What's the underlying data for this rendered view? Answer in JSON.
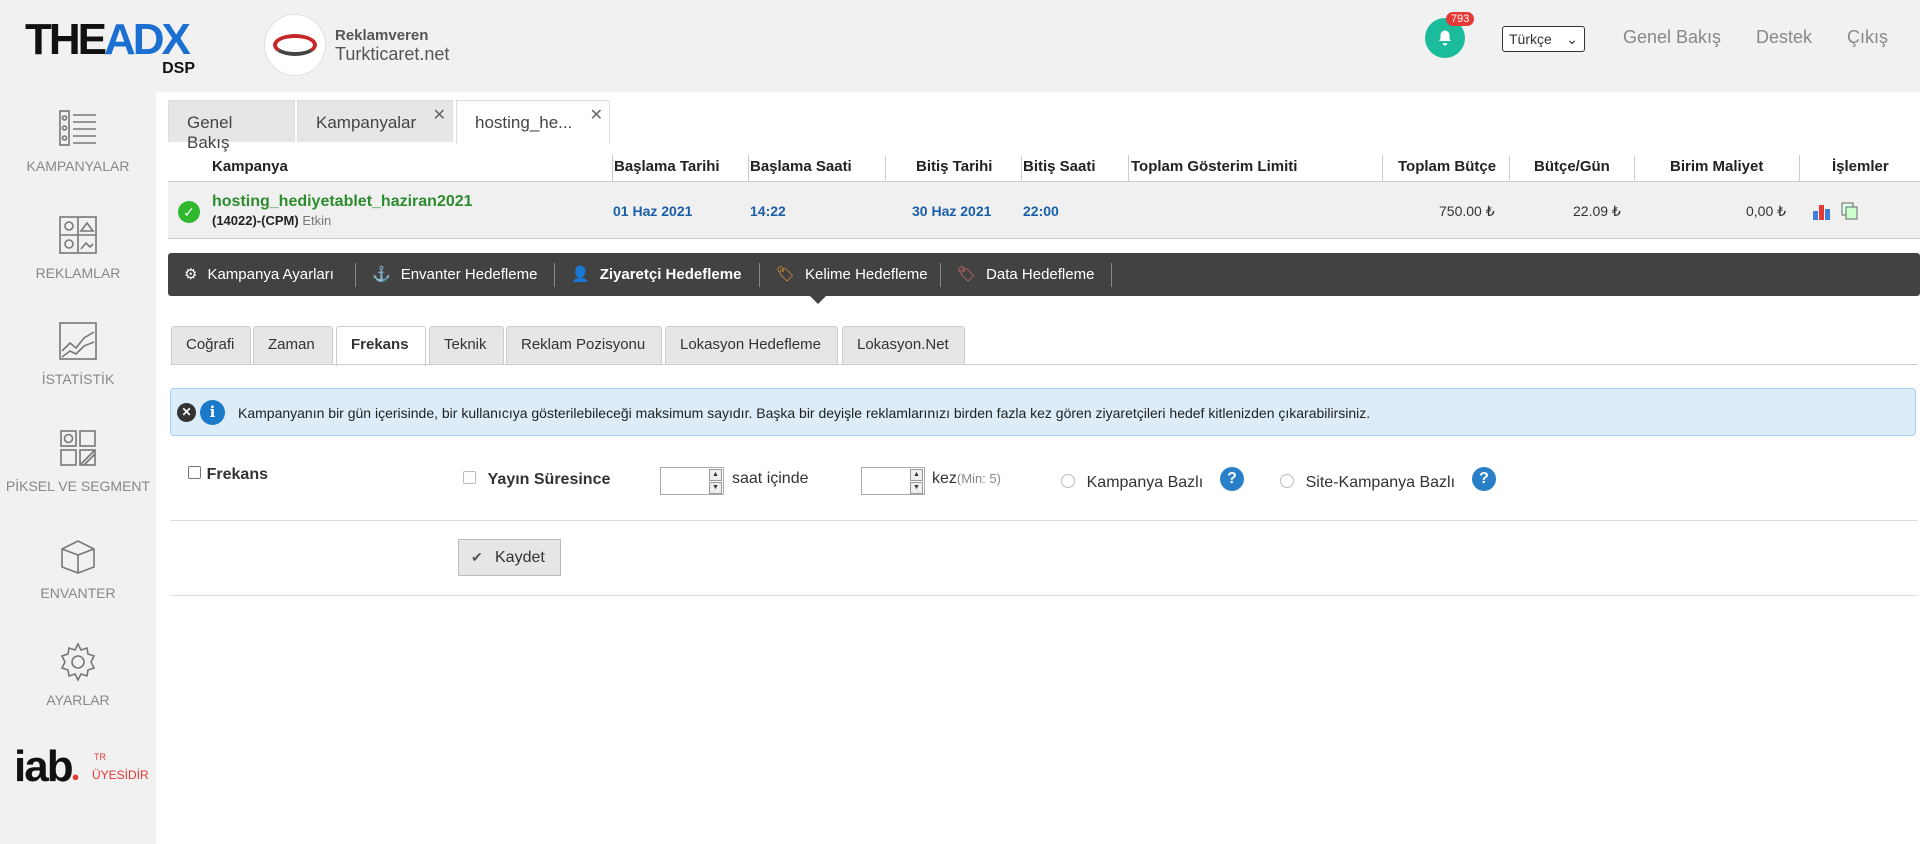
{
  "brand": {
    "logo_main_a": "THE",
    "logo_main_b": "ADX",
    "logo_sub": "DSP"
  },
  "advertiser": {
    "label": "Reklamveren",
    "name": "Turkticaret.net"
  },
  "notifications": {
    "count": "793"
  },
  "language": {
    "selected": "Türkçe"
  },
  "topnav": {
    "overview": "Genel Bakış",
    "support": "Destek",
    "logout": "Çıkış"
  },
  "sidebar": {
    "items": [
      {
        "label": "KAMPANYALAR"
      },
      {
        "label": "REKLAMLAR"
      },
      {
        "label": "İSTATİSTİK"
      },
      {
        "label": "PİKSEL VE SEGMENT"
      },
      {
        "label": "ENVANTER"
      },
      {
        "label": "AYARLAR"
      }
    ],
    "iab": {
      "word": "iab",
      "tr": "TR",
      "member": "ÜYESİDİR"
    }
  },
  "page_tabs": [
    {
      "label": "Genel Bakış"
    },
    {
      "label": "Kampanyalar"
    },
    {
      "label": "hosting_he..."
    }
  ],
  "table": {
    "headers": {
      "campaign": "Kampanya",
      "start_date": "Başlama Tarihi",
      "start_time": "Başlama Saati",
      "end_date": "Bitiş Tarihi",
      "end_time": "Bitiş Saati",
      "impression_limit": "Toplam Gösterim Limiti",
      "total_budget": "Toplam Bütçe",
      "budget_day": "Bütçe/Gün",
      "unit_cost": "Birim Maliyet",
      "actions": "İşlemler"
    },
    "row": {
      "name": "hosting_hediyetablet_haziran2021",
      "code": "(14022)-(CPM)",
      "status": "Etkin",
      "start_date": "01 Haz 2021",
      "start_time": "14:22",
      "end_date": "30 Haz 2021",
      "end_time": "22:00",
      "total_budget": "750.00 ₺",
      "budget_day": "22.09 ₺",
      "unit_cost": "0,00 ₺"
    }
  },
  "toolbar": {
    "items": [
      {
        "label": "Kampanya Ayarları"
      },
      {
        "label": "Envanter Hedefleme"
      },
      {
        "label": "Ziyaretçi Hedefleme"
      },
      {
        "label": "Kelime Hedefleme"
      },
      {
        "label": "Data Hedefleme"
      }
    ]
  },
  "subtabs": [
    {
      "label": "Coğrafi"
    },
    {
      "label": "Zaman"
    },
    {
      "label": "Frekans"
    },
    {
      "label": "Teknik"
    },
    {
      "label": "Reklam Pozisyonu"
    },
    {
      "label": "Lokasyon Hedefleme"
    },
    {
      "label": "Lokasyon.Net"
    }
  ],
  "info": {
    "text": "Kampanyanın bir gün içerisinde, bir kullanıcıya gösterilebileceği maksimum sayıdır. Başka bir deyişle reklamlarınızı birden fazla kez gören ziyaretçileri hedef kitlenizden çıkarabilirsiniz."
  },
  "frequency_form": {
    "frequency_label": "Frekans",
    "broadcast_label": "Yayın Süresince",
    "hours_suffix": "saat içinde",
    "times_suffix": "kez",
    "times_min": "(Min: 5)",
    "campaign_based": "Kampanya Bazlı",
    "site_campaign_based": "Site-Kampanya Bazlı",
    "save_label": "Kaydet"
  }
}
